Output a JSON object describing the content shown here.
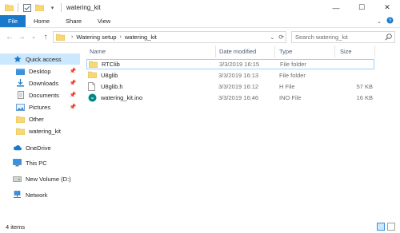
{
  "window": {
    "title": "watering_kit",
    "controls": {
      "minimize": "—",
      "maximize": "☐",
      "close": "✕"
    }
  },
  "ribbon": {
    "tabs": [
      "File",
      "Home",
      "Share",
      "View"
    ]
  },
  "address": {
    "crumbs": [
      "Watering setup",
      "watering_kit"
    ]
  },
  "search": {
    "placeholder": "Search watering_kit"
  },
  "nav_pane": {
    "items": [
      {
        "label": "Quick access",
        "icon": "star-icon",
        "selected": true
      },
      {
        "label": "Desktop",
        "icon": "desktop-folder-icon",
        "pinned": true
      },
      {
        "label": "Downloads",
        "icon": "download-icon",
        "pinned": true
      },
      {
        "label": "Documents",
        "icon": "documents-icon",
        "pinned": true
      },
      {
        "label": "Pictures",
        "icon": "pictures-icon",
        "pinned": true
      },
      {
        "label": "Other",
        "icon": "folder-icon"
      },
      {
        "label": "watering_kit",
        "icon": "folder-icon"
      },
      {
        "label": "OneDrive",
        "icon": "cloud-icon"
      },
      {
        "label": "This PC",
        "icon": "computer-icon"
      },
      {
        "label": "New Volume (D:)",
        "icon": "drive-icon"
      },
      {
        "label": "Network",
        "icon": "network-icon"
      }
    ]
  },
  "file_list": {
    "columns": [
      "Name",
      "Date modified",
      "Type",
      "Size"
    ],
    "rows": [
      {
        "name": "RTClib",
        "date": "3/3/2019 16:15",
        "type": "File folder",
        "size": "",
        "icon": "folder-icon",
        "selected": true
      },
      {
        "name": "U8glib",
        "date": "3/3/2019 16:13",
        "type": "File folder",
        "size": "",
        "icon": "folder-icon"
      },
      {
        "name": "U8glib.h",
        "date": "3/3/2019 16:12",
        "type": "H File",
        "size": "57 KB",
        "icon": "file-icon"
      },
      {
        "name": "watering_kit.ino",
        "date": "3/3/2019 16:46",
        "type": "INO File",
        "size": "16 KB",
        "icon": "arduino-icon"
      }
    ]
  },
  "status_bar": {
    "item_count": "4 items"
  },
  "colors": {
    "accent": "#1979ca",
    "selection": "#cce8ff",
    "folder": "#f8d775"
  }
}
